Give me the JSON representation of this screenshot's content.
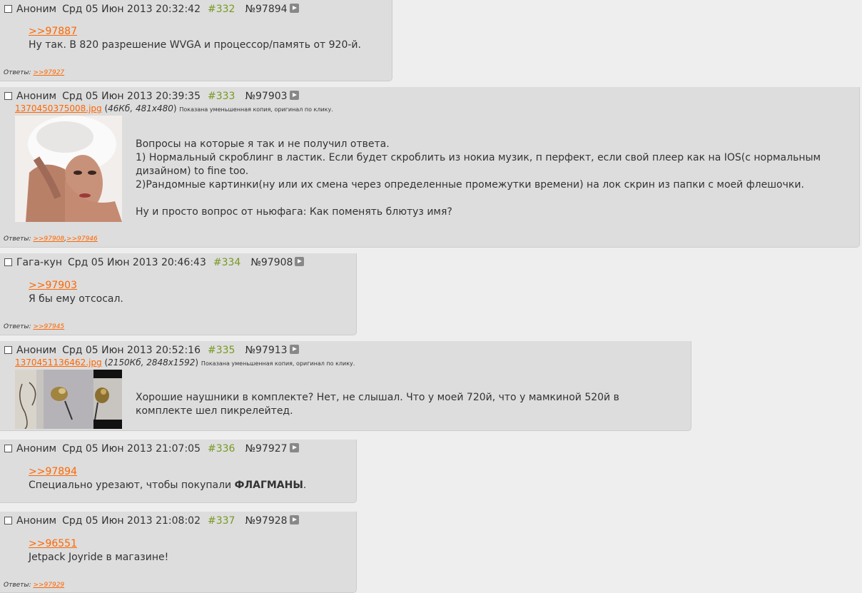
{
  "labels": {
    "answers": "Ответы:",
    "reduced_copy": "Показана уменьшенная копия, оригинал по клику."
  },
  "posts": [
    {
      "name": "Аноним",
      "date": "Срд 05 Июн 2013 20:32:42",
      "num": "#332",
      "no": "№97894",
      "reply": ">>97887",
      "lines": [
        "Ну так. В 820 разрешение WVGA и процессор/память от 920-й."
      ],
      "answers": [
        ">>97927"
      ]
    },
    {
      "name": "Аноним",
      "date": "Срд 05 Июн 2013 20:39:35",
      "num": "#333",
      "no": "№97903",
      "file": {
        "name": "1370450375008.jpg",
        "info": "46Кб, 481x480"
      },
      "lines": [
        "Вопросы на которые я так и не получил ответа.",
        "1) Нормальный скроблинг в ластик. Если будет скроблить из нокиа музик, п перфект, если свой плеер как на IOS(с нормальным",
        "дизайном) to fine too.",
        "2)Рандомные картинки(ну или их смена через определенные промежутки времени) на лок скрин из папки с моей флешочки.",
        "",
        "Ну и просто вопрос от ньюфага: Как поменять блютуз имя?"
      ],
      "answers": [
        ">>97908",
        ">>97946"
      ]
    },
    {
      "name": "Гага-кун",
      "date": "Срд 05 Июн 2013 20:46:43",
      "num": "#334",
      "no": "№97908",
      "reply": ">>97903",
      "lines": [
        "Я бы ему отсосал."
      ],
      "answers": [
        ">>97945"
      ]
    },
    {
      "name": "Аноним",
      "date": "Срд 05 Июн 2013 20:52:16",
      "num": "#335",
      "no": "№97913",
      "file": {
        "name": "1370451136462.jpg",
        "info": "2150Кб, 2848x1592"
      },
      "lines": [
        "Хорошие наушники в комплекте? Нет, не слышал. Что у моей 720й, что у мамкиной 520й в",
        "комплекте шел пикрелейтед."
      ]
    },
    {
      "name": "Аноним",
      "date": "Срд 05 Июн 2013 21:07:05",
      "num": "#336",
      "no": "№97927",
      "reply": ">>97894",
      "text_pre": "Специально урезают, чтобы покупали ",
      "text_bold": "ФЛАГМАНЫ",
      "text_post": "."
    },
    {
      "name": "Аноним",
      "date": "Срд 05 Июн 2013 21:08:02",
      "num": "#337",
      "no": "№97928",
      "reply": ">>96551",
      "lines": [
        "Jetpack Joyride в магазине!"
      ],
      "answers": [
        ">>97929"
      ]
    }
  ]
}
